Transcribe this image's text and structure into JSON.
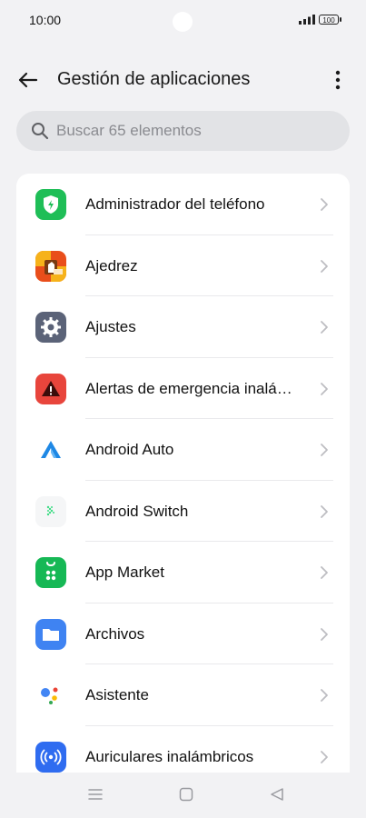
{
  "status": {
    "time": "10:00",
    "battery": "100"
  },
  "header": {
    "title": "Gestión de aplicaciones"
  },
  "search": {
    "placeholder": "Buscar 65 elementos"
  },
  "apps": [
    {
      "label": "Administrador del teléfono",
      "icon": "phone-manager-icon"
    },
    {
      "label": "Ajedrez",
      "icon": "chess-icon"
    },
    {
      "label": "Ajustes",
      "icon": "settings-gear-icon"
    },
    {
      "label": "Alertas de emergencia inalá…",
      "icon": "emergency-alert-icon"
    },
    {
      "label": "Android Auto",
      "icon": "android-auto-icon"
    },
    {
      "label": "Android Switch",
      "icon": "android-switch-icon"
    },
    {
      "label": "App Market",
      "icon": "app-market-icon"
    },
    {
      "label": "Archivos",
      "icon": "folder-icon"
    },
    {
      "label": "Asistente",
      "icon": "assistant-icon"
    },
    {
      "label": "Auriculares inalámbricos",
      "icon": "wireless-earphones-icon"
    }
  ],
  "colors": {
    "background": "#f2f2f4",
    "card": "#ffffff",
    "search_bg": "#e2e3e6"
  }
}
